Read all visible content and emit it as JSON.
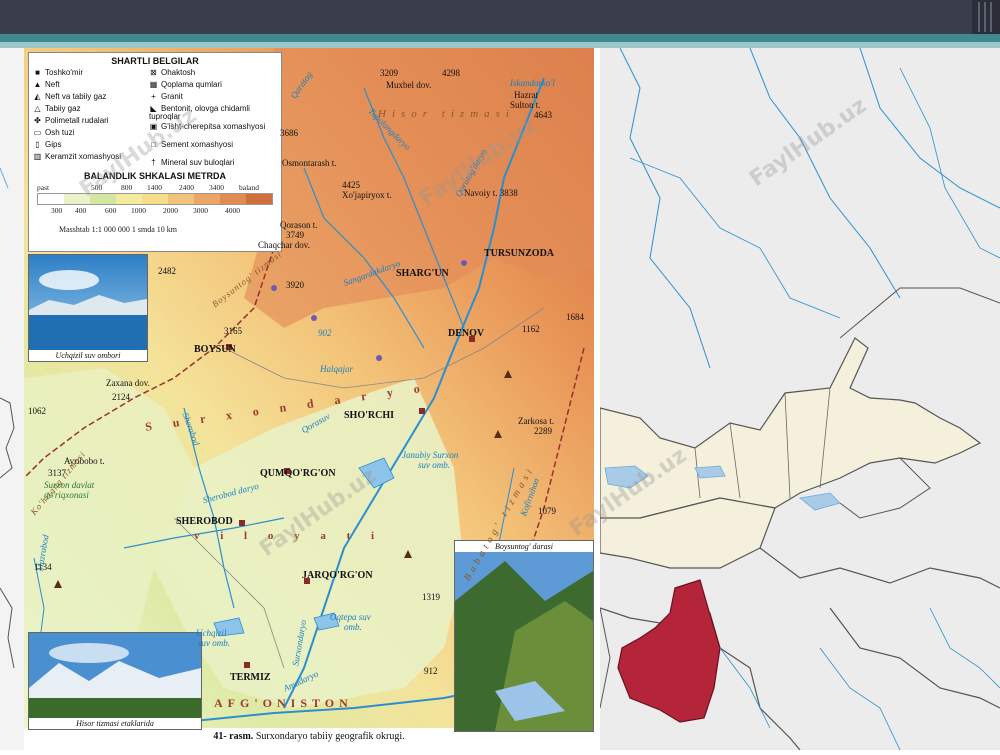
{
  "slide": {
    "watermark": "FaylHub.uz"
  },
  "legend": {
    "title": "SHARTLI BELGILAR",
    "items": [
      {
        "label": "Toshko'mir",
        "symbol": "■"
      },
      {
        "label": "Ohaktosh",
        "symbol": "⊠"
      },
      {
        "label": "Neft",
        "symbol": "▲"
      },
      {
        "label": "Qoplama qumlari",
        "symbol": "▦"
      },
      {
        "label": "Neft va tabiiy gaz",
        "symbol": "◭"
      },
      {
        "label": "Granit",
        "symbol": "+"
      },
      {
        "label": "Tabiiy gaz",
        "symbol": "△"
      },
      {
        "label": "Bentonit, olovga chidamli tuproqlar",
        "symbol": "◣"
      },
      {
        "label": "Polimetall rudalari",
        "symbol": "✤"
      },
      {
        "label": "G'isht-cherepitsa xomashyosi",
        "symbol": "▣"
      },
      {
        "label": "Osh tuzi",
        "symbol": "▭"
      },
      {
        "label": "Sement xomashyosi",
        "symbol": "□"
      },
      {
        "label": "Gips",
        "symbol": "▯"
      },
      {
        "label": "Mineral suv buloqlari",
        "symbol": "†"
      },
      {
        "label": "Keramzit xomashyosi",
        "symbol": "▥"
      }
    ],
    "scale_title": "BALANDLIK SHKALASI METRDA",
    "scale_top": [
      "past",
      "500",
      "800",
      "1400",
      "2400",
      "3400",
      "baland"
    ],
    "scale_bottom": [
      "300",
      "400",
      "600",
      "1000",
      "2000",
      "3000",
      "4000"
    ],
    "scale_colors": [
      "#ffffff",
      "#e9f2c8",
      "#d4e7a2",
      "#f3ec9c",
      "#f5dd8a",
      "#f1c37a",
      "#eca468",
      "#e18a52",
      "#d06f3c"
    ],
    "masshtab": "Masshtab 1:1 000 000  1 smda 10 km"
  },
  "photos": {
    "top": "Uchqizil suv ombori",
    "bottom": "Hisor tizmasi etaklarida",
    "right": "Boysuntog' darasi"
  },
  "caption": {
    "number": "41- rasm.",
    "text": "Surxondaryo tabiiy geografik okrugi."
  },
  "map": {
    "cities": [
      "TURSUNZODA",
      "SHARG'UN",
      "BOYSUN",
      "DENOV",
      "SHO'RCHI",
      "QUMQO'RG'ON",
      "SHEROBOD",
      "JARQO'RG'ON",
      "TERMIZ"
    ],
    "peaks": [
      "3209",
      "4298",
      "Muxbel dov.",
      "Hazrat",
      "Sulton t.",
      "4643",
      "3686",
      "Osmontarash t.",
      "4425",
      "Xo'japiryox t.",
      "Navoiy t. 3838",
      "Qorason t.",
      "3749",
      "Chaqchar dov.",
      "3920",
      "2482",
      "3165",
      "1162",
      "1684",
      "Zaxana dov.",
      "2124",
      "Zarkosa t.",
      "2289",
      "Ayribobo t.",
      "3137",
      "1079",
      "1134",
      "1319",
      "912",
      "1062"
    ],
    "water": [
      "Qaratag",
      "Iskandarko'l",
      "Tupolangdaryo",
      "Sangardakdaryo",
      "Qoratog'daryo",
      "902",
      "Halqajar",
      "Sherobod",
      "Qorasuv",
      "Janubiy Surxon",
      "suv omb.",
      "Sherobod daryo",
      "Surxon davlat",
      "qo'riqxonasi",
      "Uchqizil",
      "suv omb.",
      "Surxondaryo",
      "Oqtepa suv",
      "omb.",
      "Amudaryo",
      "Mazrabod",
      "Kofirnihon"
    ],
    "ranges": [
      "Hisor tizmasi",
      "Boysuntog' tizmasi",
      "Ko'hitang tizmasi",
      "Babatog' tizmasi"
    ],
    "region": "S u r x o n d a r y o",
    "region2": "v i l o y a t i",
    "country": "AFG'ONISTON"
  },
  "colors": {
    "highlight_region": "#b5253a",
    "water": "#2a8fd0",
    "border": "#444444"
  }
}
